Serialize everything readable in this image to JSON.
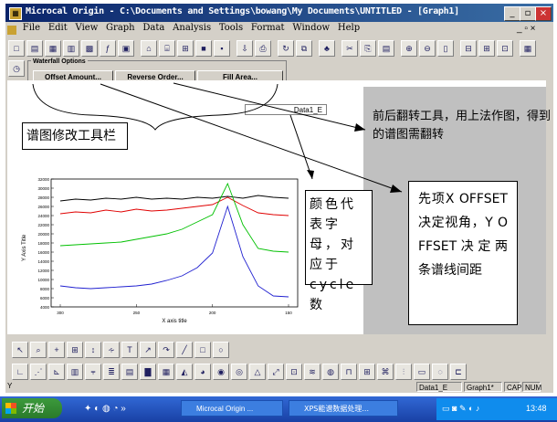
{
  "window": {
    "title": "Microcal Origin - C:\\Documents and Settings\\bowang\\My Documents\\UNTITLED - [Graph1]",
    "app_icon": "origin-graph-icon",
    "controls": [
      "_",
      "▫",
      "×"
    ]
  },
  "menu": {
    "items": [
      "File",
      "Edit",
      "View",
      "Graph",
      "Data",
      "Analysis",
      "Tools",
      "Format",
      "Window",
      "Help"
    ],
    "doc_controls": "_ ▫ ×"
  },
  "waterfall": {
    "title": "Waterfall Options",
    "buttons": [
      "Offset Amount...",
      "Reverse Order...",
      "Fill Area..."
    ]
  },
  "graph": {
    "layer_label": "Data1_E"
  },
  "annotations": {
    "toolbar_label": "谱图修改工具栏",
    "reverse_note": "前后翻转工具，用上法作图，得到的谱图需翻转",
    "color_note": "颜色代表字母，对应于cycle数",
    "offset_note": "先项X OFFSET决定视角，Y OFFSET决定两条谱线间距"
  },
  "status": {
    "left": "Y",
    "cells": [
      "Data1_E",
      "Graph1*",
      "CAP",
      "NUM"
    ]
  },
  "taskbar": {
    "start": "开始",
    "tasks": [
      "Microcal Origin ...",
      "XPS能谱数据处理..."
    ],
    "clock": "13:48"
  },
  "colors": {
    "titlebar": "#0a246a",
    "series_black": "#000000",
    "series_red": "#e00000",
    "series_green": "#00c000",
    "series_blue": "#2020d0"
  },
  "chart_data": {
    "type": "line",
    "title": "",
    "xlabel": "X axis title",
    "ylabel": "Y Axis Title",
    "x_ticks": [
      "300",
      "250",
      "200",
      "150"
    ],
    "y_ticks": [
      "32000",
      "30000",
      "28000",
      "26000",
      "24000",
      "22000",
      "20000",
      "18000",
      "16000",
      "14000",
      "12000",
      "10000",
      "8000",
      "6000",
      "4000"
    ],
    "ylim": [
      4000,
      32000
    ],
    "x_inverted": true,
    "series": [
      {
        "color": "#000000",
        "x": [
          300,
          290,
          280,
          270,
          260,
          250,
          240,
          230,
          220,
          210,
          200,
          190,
          180,
          170,
          160,
          150
        ],
        "y": [
          27200,
          27600,
          27400,
          27800,
          27600,
          28000,
          27600,
          27800,
          27600,
          28000,
          27800,
          28200,
          27800,
          28400,
          28000,
          27800
        ]
      },
      {
        "color": "#e00000",
        "x": [
          300,
          290,
          280,
          270,
          260,
          250,
          240,
          230,
          220,
          210,
          200,
          190,
          180,
          170,
          160,
          150
        ],
        "y": [
          24400,
          24800,
          24600,
          25200,
          24800,
          25400,
          25000,
          25200,
          25600,
          26000,
          26400,
          28000,
          26200,
          24600,
          24200,
          24000
        ]
      },
      {
        "color": "#00c000",
        "x": [
          300,
          290,
          280,
          270,
          260,
          250,
          240,
          230,
          220,
          210,
          200,
          190,
          180,
          170,
          160,
          150
        ],
        "y": [
          17400,
          17600,
          17800,
          18000,
          18200,
          18800,
          19400,
          20000,
          21000,
          22600,
          24200,
          31000,
          22000,
          16800,
          16200,
          16000
        ]
      },
      {
        "color": "#2020d0",
        "x": [
          300,
          290,
          280,
          270,
          260,
          250,
          240,
          230,
          220,
          210,
          200,
          190,
          180,
          170,
          160,
          150
        ],
        "y": [
          8600,
          8200,
          8000,
          8200,
          8400,
          8600,
          9000,
          9800,
          10800,
          12600,
          15800,
          26000,
          15000,
          8600,
          6400,
          6200
        ]
      }
    ]
  }
}
